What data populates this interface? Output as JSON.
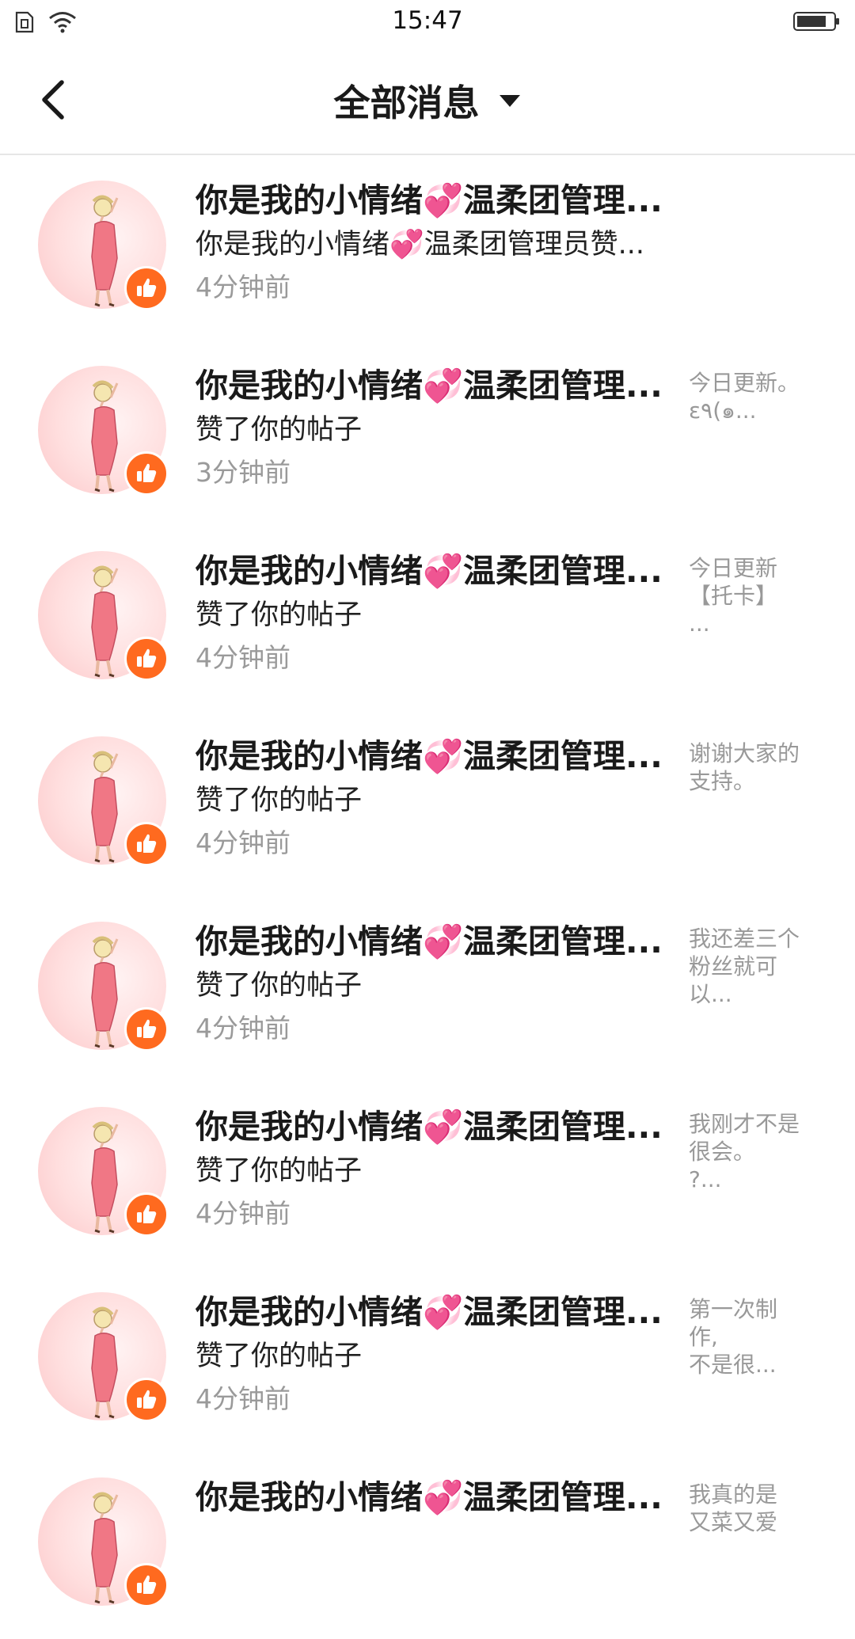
{
  "status_bar": {
    "time": "15:47",
    "icons": [
      "sim-icon",
      "wifi-icon",
      "battery-icon"
    ]
  },
  "nav": {
    "back_icon": "chevron-left-icon",
    "title": "全部消息",
    "dropdown_icon": "caret-down-icon"
  },
  "colors": {
    "accent": "#ff6a1f",
    "muted_text": "#9a9a9a",
    "divider": "#e6e6e6"
  },
  "messages": [
    {
      "title": "你是我的小情绪💞温柔团管理...",
      "subtitle": "你是我的小情绪💞温柔团管理员赞...",
      "time": "4分钟前",
      "preview": ""
    },
    {
      "title": "你是我的小情绪💞温柔团管理...",
      "subtitle": "赞了你的帖子",
      "time": "3分钟前",
      "preview": "今日更新。\nε٩(๑..."
    },
    {
      "title": "你是我的小情绪💞温柔团管理...",
      "subtitle": "赞了你的帖子",
      "time": "4分钟前",
      "preview": "今日更新\n【托卡】\n..."
    },
    {
      "title": "你是我的小情绪💞温柔团管理...",
      "subtitle": "赞了你的帖子",
      "time": "4分钟前",
      "preview": "谢谢大家的\n支持。"
    },
    {
      "title": "你是我的小情绪💞温柔团管理...",
      "subtitle": "赞了你的帖子",
      "time": "4分钟前",
      "preview": "我还差三个\n粉丝就可\n以..."
    },
    {
      "title": "你是我的小情绪💞温柔团管理...",
      "subtitle": "赞了你的帖子",
      "time": "4分钟前",
      "preview": "我刚才不是\n很会。\n?..."
    },
    {
      "title": "你是我的小情绪💞温柔团管理...",
      "subtitle": "赞了你的帖子",
      "time": "4分钟前",
      "preview": "第一次制\n作,\n不是很..."
    },
    {
      "title": "你是我的小情绪💞温柔团管理...",
      "subtitle": "",
      "time": "",
      "preview": "我真的是\n又菜又爱"
    }
  ]
}
